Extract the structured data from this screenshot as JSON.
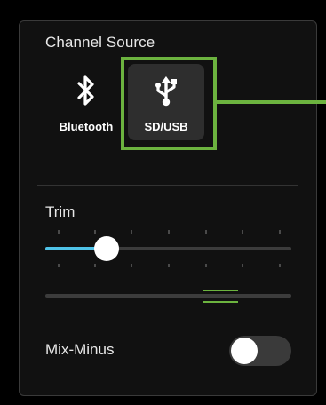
{
  "channel_source": {
    "title": "Channel Source",
    "sources": [
      {
        "label": "Bluetooth",
        "icon": "bluetooth-icon",
        "selected": false
      },
      {
        "label": "SD/USB",
        "icon": "usb-icon",
        "selected": true
      }
    ],
    "highlight_color": "#6cb33f"
  },
  "trim": {
    "label": "Trim",
    "level": 0.25,
    "accent": "#4fc3e8"
  },
  "meter": {
    "level": 0.71
  },
  "mix_minus": {
    "label": "Mix-Minus",
    "enabled": false
  }
}
